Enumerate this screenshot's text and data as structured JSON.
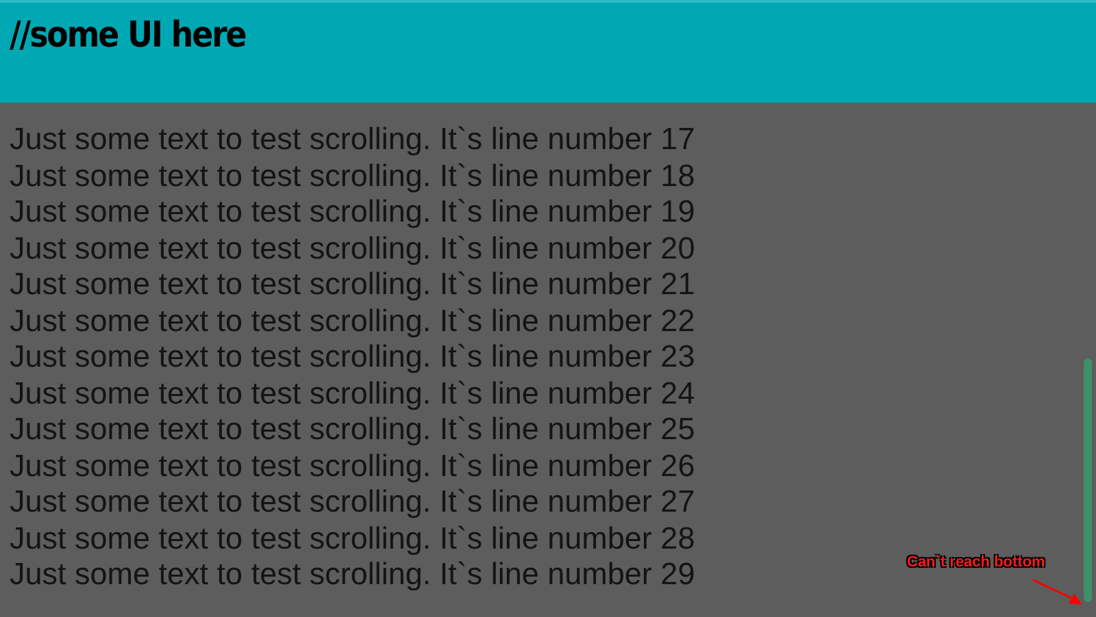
{
  "header": {
    "title": "//some UI here"
  },
  "lines": [
    "Just some text to test scrolling. It`s line number 17",
    "Just some text to test scrolling. It`s line number 18",
    "Just some text to test scrolling. It`s line number 19",
    "Just some text to test scrolling. It`s line number 20",
    "Just some text to test scrolling. It`s line number 21",
    "Just some text to test scrolling. It`s line number 22",
    "Just some text to test scrolling. It`s line number 23",
    "Just some text to test scrolling. It`s line number 24",
    "Just some text to test scrolling. It`s line number 25",
    "Just some text to test scrolling. It`s line number 26",
    "Just some text to test scrolling. It`s line number 27",
    "Just some text to test scrolling. It`s line number 28",
    "Just some text to test scrolling. It`s line number 29"
  ],
  "annotation": {
    "text": "Can`t reach bottom"
  }
}
